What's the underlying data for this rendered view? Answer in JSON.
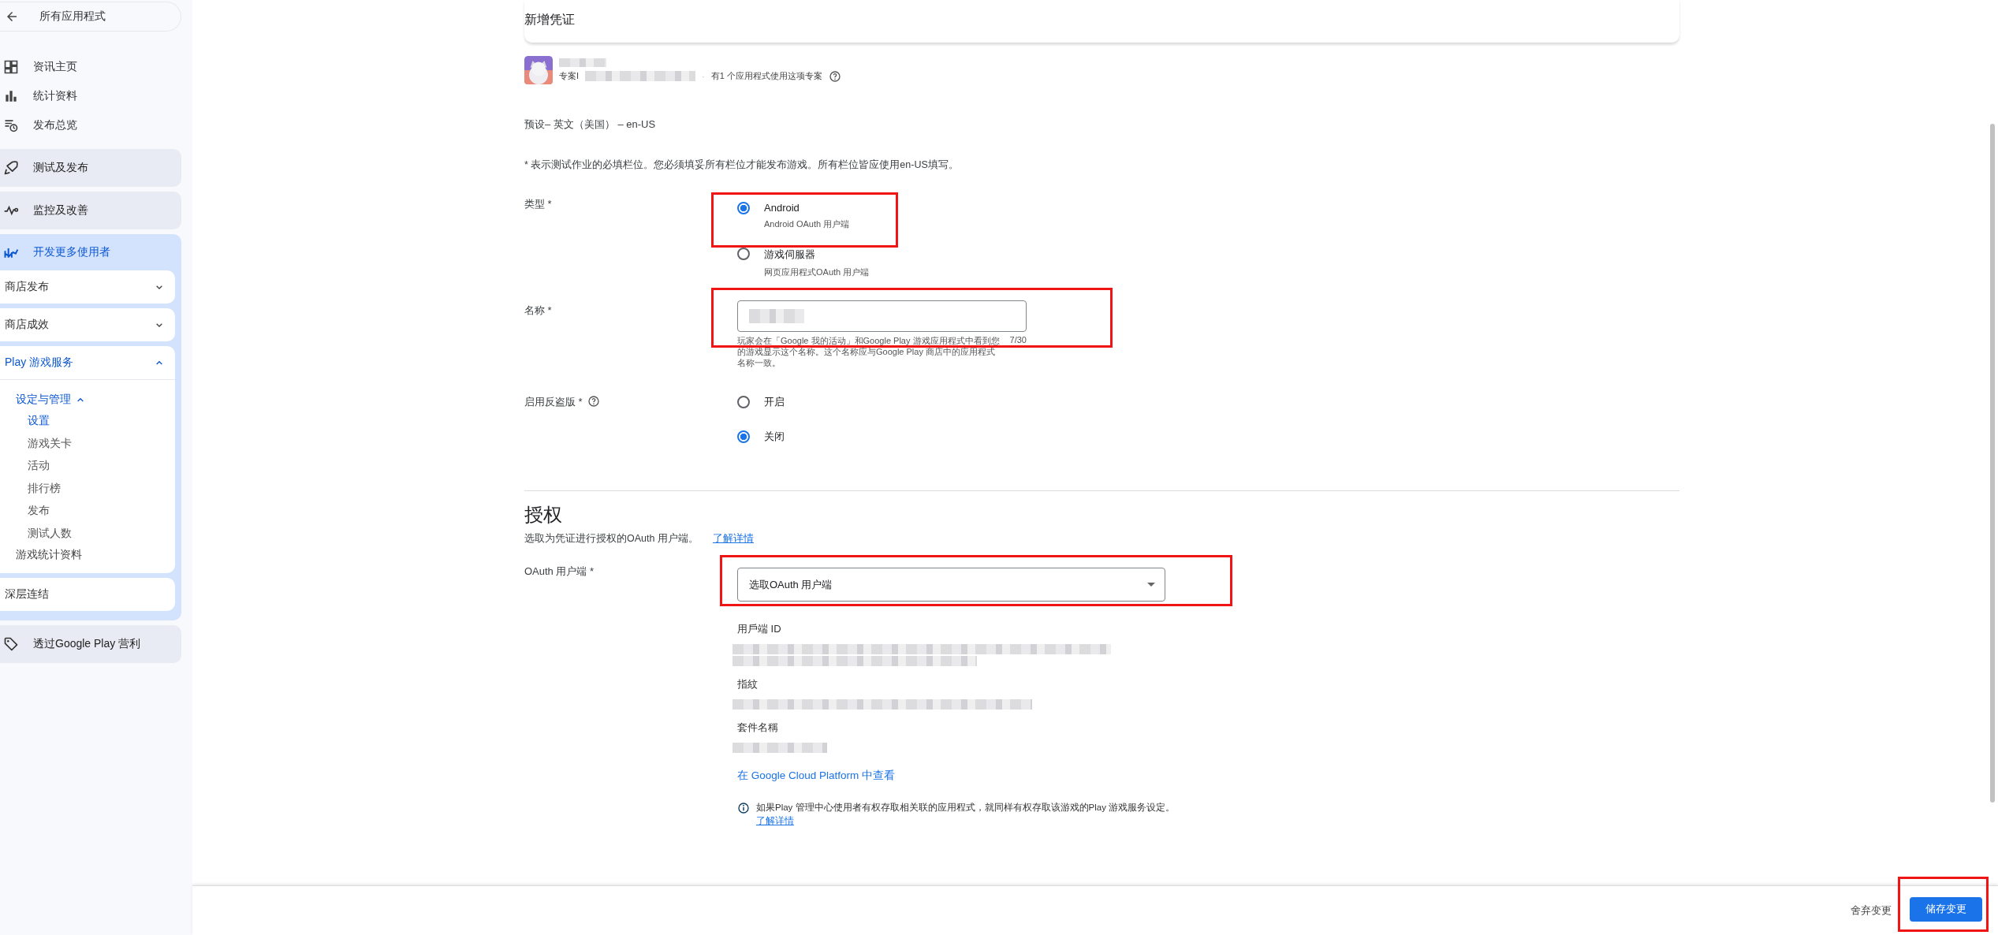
{
  "sidebar": {
    "back_label": "所有应用程式",
    "nav_links": [
      {
        "label": "资讯主页"
      },
      {
        "label": "统计资料"
      },
      {
        "label": "发布总览"
      }
    ],
    "sections": [
      {
        "label": "测试及发布",
        "expanded": false
      },
      {
        "label": "监控及改善",
        "expanded": false
      },
      {
        "label": "开发更多使用者",
        "expanded": true,
        "children": [
          {
            "label": "商店发布",
            "expanded": false
          },
          {
            "label": "商店成效",
            "expanded": false
          },
          {
            "label": "Play 游戏服务",
            "expanded": true,
            "children": [
              {
                "label": "设定与管理",
                "expanded": true,
                "children": [
                  {
                    "label": "设置",
                    "selected": true
                  },
                  {
                    "label": "游戏关卡",
                    "selected": false
                  },
                  {
                    "label": "活动",
                    "selected": false
                  },
                  {
                    "label": "排行榜",
                    "selected": false
                  },
                  {
                    "label": "发布",
                    "selected": false
                  },
                  {
                    "label": "测试人数",
                    "selected": false
                  }
                ]
              },
              {
                "label": "游戏统计资料"
              }
            ]
          },
          {
            "label": "深层连结"
          }
        ]
      },
      {
        "label": "透过Google Play 营利",
        "expanded": false
      }
    ]
  },
  "page": {
    "title": "新增凭证",
    "project": {
      "id_label": "专案I",
      "separator": "·",
      "apps_note": "有1 个应用程式使用这项专案"
    },
    "language": "预设– 英文（美国） – en-US",
    "required_note": "* 表示测试作业的必填栏位。您必须填妥所有栏位才能发布游戏。所有栏位皆应使用en-US填写。",
    "type_field": {
      "label": "类型 *",
      "options": [
        {
          "label": "Android",
          "sublabel": "Android OAuth 用户端",
          "selected": true
        },
        {
          "label": "游戏伺服器",
          "sublabel": "网页应用程式OAuth 用户端",
          "selected": false
        }
      ]
    },
    "name_field": {
      "label": "名称 *",
      "helper": "玩家会在「Google 我的活动」和Google Play 游戏应用程式中看到您的游戏显示这个名称。这个名称应与Google Play 商店中的应用程式名称一致。",
      "counter": "7/30"
    },
    "antipiracy_field": {
      "label": "启用反盗版 *",
      "options": [
        {
          "label": "开启",
          "selected": false
        },
        {
          "label": "关闭",
          "selected": true
        }
      ]
    },
    "authorization": {
      "heading": "授权",
      "description": "选取为凭证进行授权的OAuth 用户端。",
      "learn_more": "了解详情",
      "oauth_field": {
        "label": "OAuth 用户端 *",
        "placeholder": "选取OAuth 用户端"
      },
      "details": [
        {
          "label": "用戶端 ID"
        },
        {
          "label": "指紋"
        },
        {
          "label": "套件名稱"
        }
      ],
      "cloud_link": "在 Google Cloud Platform 中查看",
      "info": {
        "text": "如果Play 管理中心使用者有权存取相关联的应用程式，就同样有权存取该游戏的Play 游戏服务设定。",
        "link": "了解详情"
      }
    }
  },
  "footer": {
    "discard": "舍弃变更",
    "save": "储存变更"
  }
}
